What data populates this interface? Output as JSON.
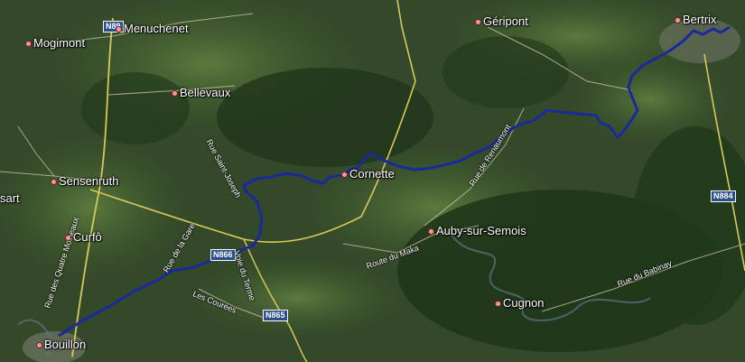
{
  "places": [
    {
      "id": "mogimont",
      "name": "Mogimont"
    },
    {
      "id": "menuchenet",
      "name": "Menuchenet"
    },
    {
      "id": "bellevaux",
      "name": "Bellevaux"
    },
    {
      "id": "geripont",
      "name": "Géripont"
    },
    {
      "id": "bertrix",
      "name": "Bertrix"
    },
    {
      "id": "sensenruth",
      "name": "Sensenruth"
    },
    {
      "id": "sart",
      "name": "sart"
    },
    {
      "id": "curfoz",
      "name": "Curfô"
    },
    {
      "id": "cornette",
      "name": "Cornette"
    },
    {
      "id": "auby",
      "name": "Auby-sur-Semois"
    },
    {
      "id": "cugnon",
      "name": "Cugnon"
    },
    {
      "id": "bouillon",
      "name": "Bouillon"
    }
  ],
  "streets": [
    {
      "id": "rue-saint-joseph",
      "name": "Rue Saint-Joseph"
    },
    {
      "id": "rue-de-renaumont",
      "name": "Rue de Renaumont"
    },
    {
      "id": "rue-de-la-gare",
      "name": "Rue de la Gare"
    },
    {
      "id": "route-du-maka",
      "name": "Route du Maka"
    },
    {
      "id": "rue-du-babinay",
      "name": "Rue du Babinay"
    },
    {
      "id": "rue-quatre-moineaux",
      "name": "Rue des Quatre Moineaux"
    },
    {
      "id": "les-courees",
      "name": "Les Courées"
    },
    {
      "id": "voie-du-terme",
      "name": "Voie du Terme"
    }
  ],
  "road_shields": [
    {
      "id": "n89",
      "label": "N89"
    },
    {
      "id": "n866",
      "label": "N866"
    },
    {
      "id": "n865",
      "label": "N865"
    },
    {
      "id": "n884",
      "label": "N884"
    }
  ],
  "colors": {
    "route": "#1a2a9c",
    "major_road": "#d9c85a",
    "minor_road": "#c9c2a0",
    "field": "#4a6a34",
    "forest": "#1d3318",
    "town": "#7a7a6a",
    "water": "#6c8a9a"
  }
}
